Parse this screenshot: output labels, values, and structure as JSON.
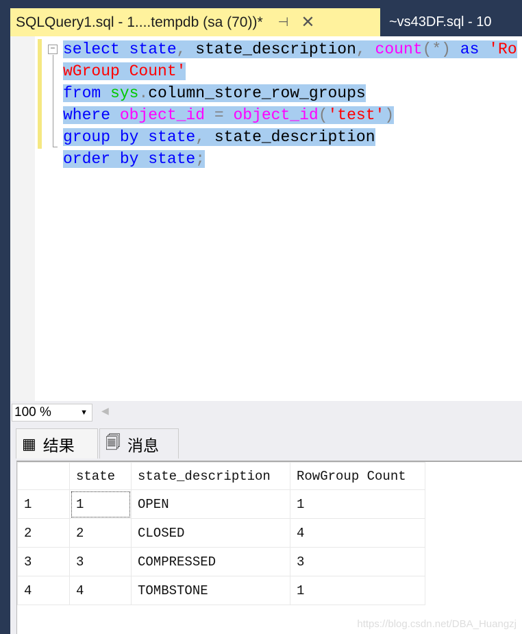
{
  "tabs": {
    "active": "SQLQuery1.sql - 1....tempdb (sa (70))*",
    "pin_icon": "pin-icon",
    "close_icon": "close-icon",
    "other": "~vs43DF.sql - 10"
  },
  "editor": {
    "fold_icon": "minus-box-icon",
    "lines": [
      [
        {
          "t": "select",
          "c": "kw"
        },
        {
          "t": " state",
          "c": "kw"
        },
        {
          "t": ",",
          "c": "p"
        },
        {
          "t": " state_description",
          "c": "id"
        },
        {
          "t": ",",
          "c": "p"
        },
        {
          "t": " count",
          "c": "fn"
        },
        {
          "t": "(*)",
          "c": "p"
        },
        {
          "t": " as",
          "c": "kw"
        },
        {
          "t": " 'RowGroup Count'",
          "c": "str"
        }
      ],
      [
        {
          "t": "from",
          "c": "kw"
        },
        {
          "t": " sys",
          "c": "sys"
        },
        {
          "t": ".",
          "c": "p"
        },
        {
          "t": "column_store_row_groups",
          "c": "id"
        }
      ],
      [
        {
          "t": "where",
          "c": "kw"
        },
        {
          "t": " object_id",
          "c": "fn"
        },
        {
          "t": " =",
          "c": "p"
        },
        {
          "t": " object_id",
          "c": "fn"
        },
        {
          "t": "(",
          "c": "p"
        },
        {
          "t": "'test'",
          "c": "str"
        },
        {
          "t": ")",
          "c": "p"
        }
      ],
      [
        {
          "t": "group by",
          "c": "kw"
        },
        {
          "t": " state",
          "c": "kw"
        },
        {
          "t": ",",
          "c": "p"
        },
        {
          "t": " state_description",
          "c": "id"
        }
      ],
      [
        {
          "t": "order by",
          "c": "kw"
        },
        {
          "t": " state",
          "c": "kw"
        },
        {
          "t": ";",
          "c": "p"
        }
      ]
    ]
  },
  "colors": {
    "kw": "#0000ff",
    "fn": "#ff00ff",
    "sys": "#00c800",
    "str": "#ff0000",
    "p": "#808080",
    "id": "#000000",
    "tab_active": "#fff29d",
    "selection": "#a8cdf0"
  },
  "zoom": {
    "value": "100 %"
  },
  "results_tabs": [
    {
      "label": "结果",
      "icon": "grid-icon"
    },
    {
      "label": "消息",
      "icon": "message-icon"
    }
  ],
  "grid": {
    "columns": [
      "",
      "state",
      "state_description",
      "RowGroup Count"
    ],
    "rows": [
      [
        "1",
        "1",
        "OPEN",
        "1"
      ],
      [
        "2",
        "2",
        "CLOSED",
        "4"
      ],
      [
        "3",
        "3",
        "COMPRESSED",
        "3"
      ],
      [
        "4",
        "4",
        "TOMBSTONE",
        "1"
      ]
    ]
  },
  "watermark": "https://blog.csdn.net/DBA_Huangzj"
}
